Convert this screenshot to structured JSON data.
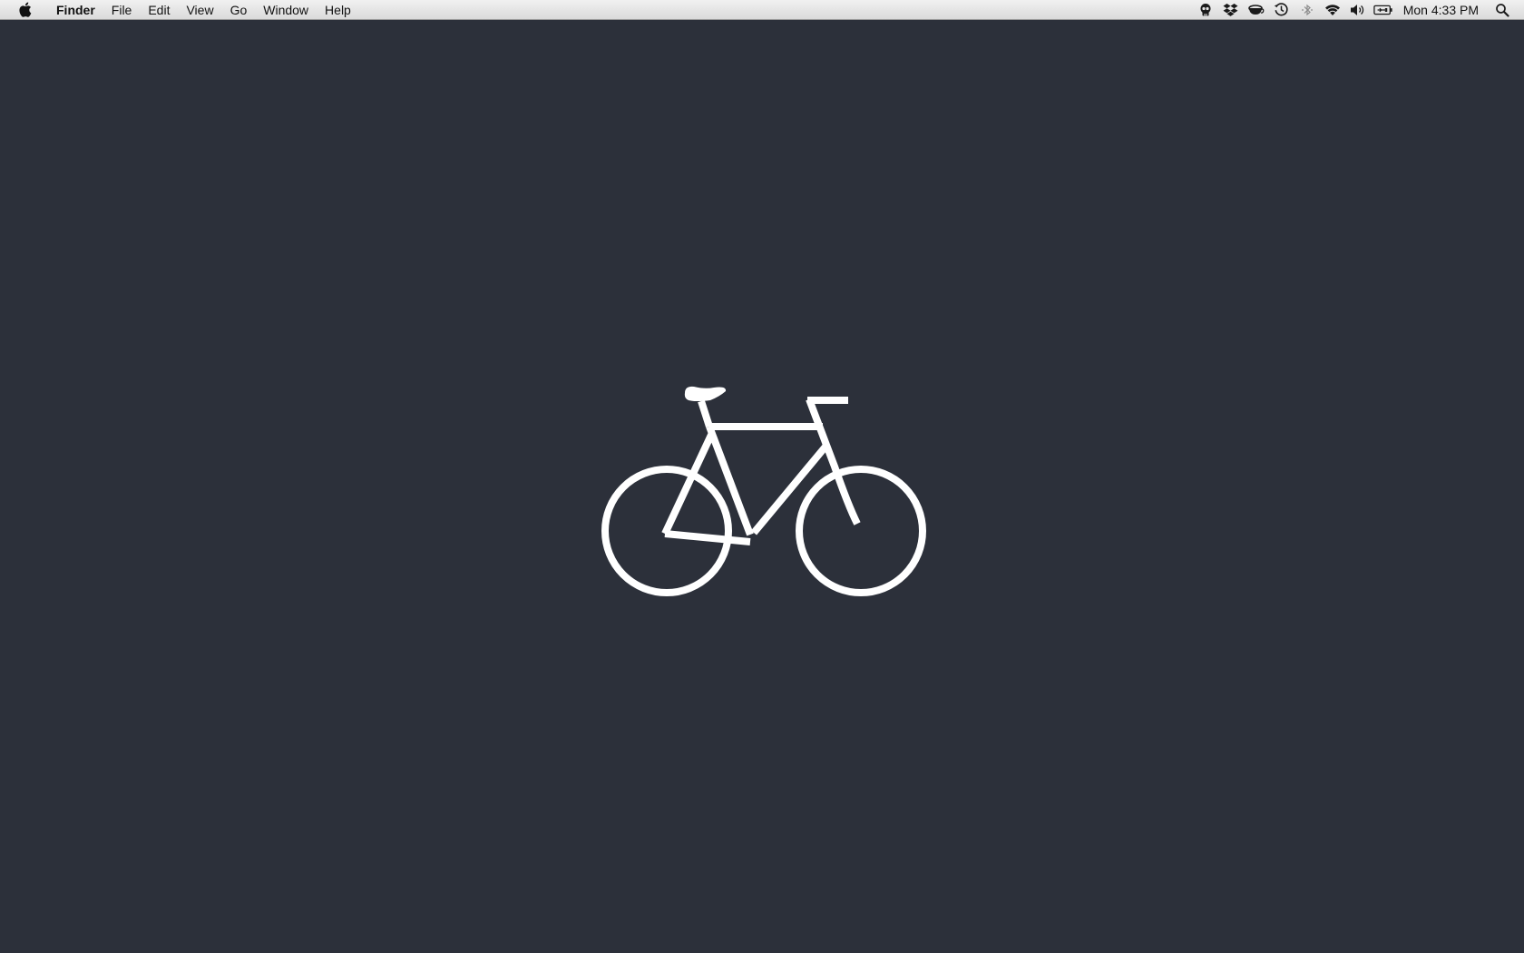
{
  "menubar": {
    "apple_icon": "apple-icon",
    "app_name": "Finder",
    "menus": [
      {
        "label": "File"
      },
      {
        "label": "Edit"
      },
      {
        "label": "View"
      },
      {
        "label": "Go"
      },
      {
        "label": "Window"
      },
      {
        "label": "Help"
      }
    ],
    "status_icons": [
      "skull-agent-icon",
      "dropbox-icon",
      "caffeine-cup-icon",
      "time-machine-icon",
      "bluetooth-icon",
      "wifi-icon",
      "volume-icon",
      "battery-icon"
    ],
    "clock": "Mon 4:33 PM",
    "spotlight_icon": "spotlight-search-icon"
  },
  "desktop": {
    "background_color": "#2c303a",
    "wallpaper_subject": "bicycle-icon",
    "art_color": "#ffffff"
  }
}
